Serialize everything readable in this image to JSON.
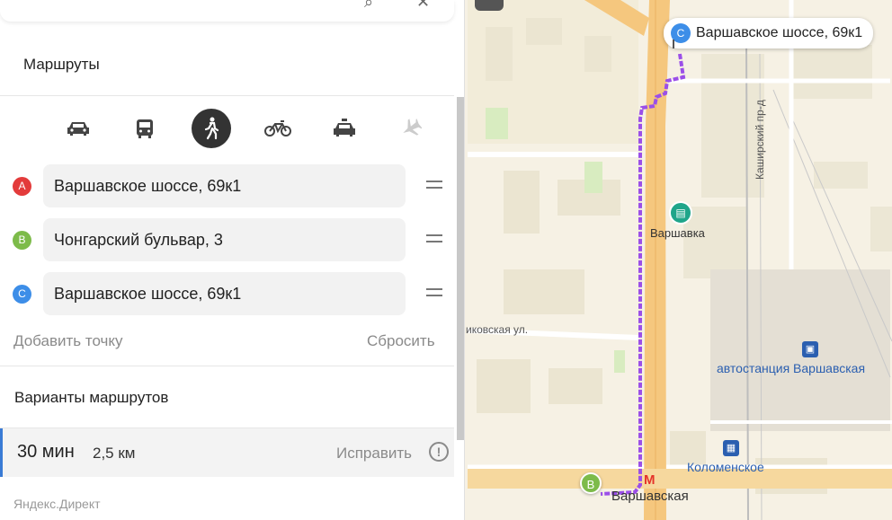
{
  "map": {
    "callout_letter": "C",
    "callout_text": "Варшавское шоссе, 69к1",
    "pin_b_letter": "B",
    "labels": {
      "varshavka": "Варшавка",
      "kashirsky": "Каширский пр-д",
      "street": "иковская ул.",
      "bus_station": "автостанция Варшавская",
      "kolomenskoye": "Коломенское",
      "metro_varshavskaya": "Варшавская",
      "metro_letter": "M"
    },
    "route_color": "#9b4fe8"
  },
  "sidebar": {
    "title": "Маршруты",
    "modes": [
      {
        "name": "car",
        "active": false
      },
      {
        "name": "bus",
        "active": false
      },
      {
        "name": "walk",
        "active": true
      },
      {
        "name": "bike",
        "active": false
      },
      {
        "name": "taxi",
        "active": false
      },
      {
        "name": "plane",
        "active": false
      }
    ],
    "points": [
      {
        "letter": "A",
        "value": "Варшавское шоссе, 69к1"
      },
      {
        "letter": "B",
        "value": "Чонгарский бульвар, 3"
      },
      {
        "letter": "C",
        "value": "Варшавское шоссе, 69к1"
      }
    ],
    "add_point": "Добавить точку",
    "reset": "Сбросить",
    "variants_title": "Варианты маршрутов",
    "route": {
      "time": "30 мин",
      "distance": "2,5 км",
      "fix": "Исправить",
      "info": "!"
    },
    "direct": "Яндекс.Директ"
  },
  "colors": {
    "accent": "#3a7bd5",
    "badge_a": "#e33b3b",
    "badge_b": "#7dbb4a",
    "badge_c": "#3d8ee8"
  }
}
